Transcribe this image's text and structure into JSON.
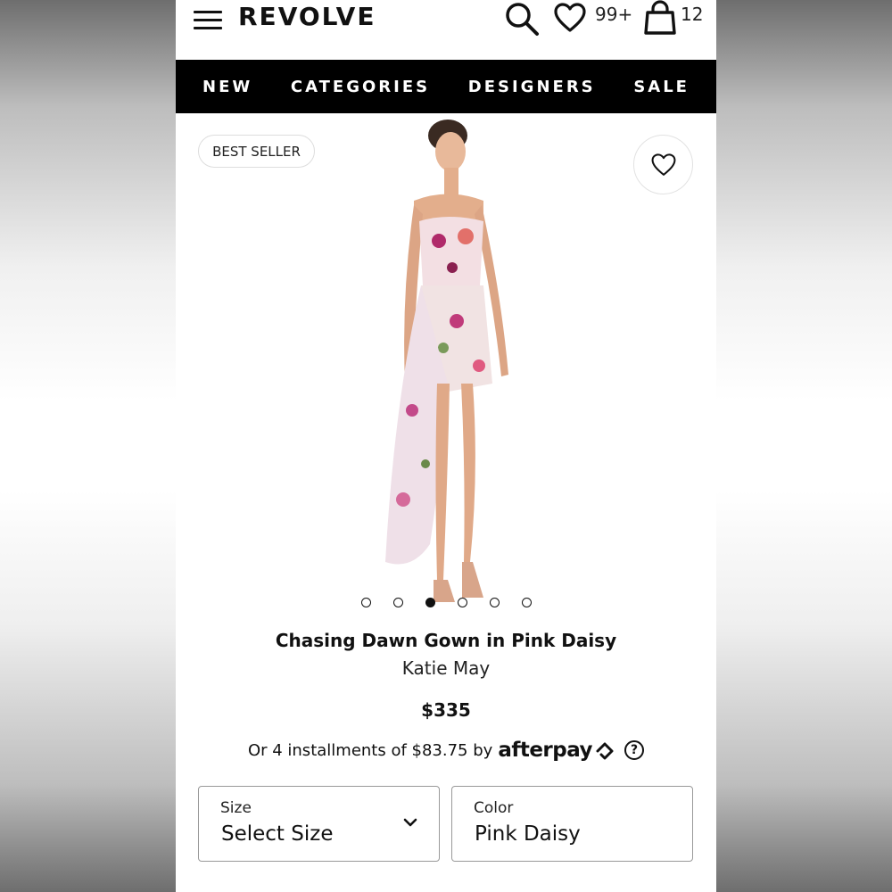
{
  "header": {
    "brand": "REVOLVE",
    "wishlist_count": "99+",
    "bag_count": "12",
    "icons": [
      "menu-icon",
      "search-icon",
      "heart-icon",
      "bag-icon"
    ]
  },
  "nav": {
    "items": [
      {
        "label": "NEW"
      },
      {
        "label": "CATEGORIES"
      },
      {
        "label": "DESIGNERS"
      },
      {
        "label": "SALE"
      }
    ]
  },
  "product": {
    "badge": "BEST SELLER",
    "title": "Chasing Dawn Gown in Pink Daisy",
    "designer": "Katie May",
    "price": "$335",
    "installments_text": "Or 4 installments of $83.75 by",
    "afterpay_brand": "afterpay",
    "image_count": 6,
    "active_image": 3
  },
  "options": {
    "size": {
      "label": "Size",
      "value": "Select Size"
    },
    "color": {
      "label": "Color",
      "value": "Pink Daisy"
    }
  },
  "colors": {
    "nav_bg": "#000000",
    "text": "#111111",
    "border": "#999999"
  }
}
